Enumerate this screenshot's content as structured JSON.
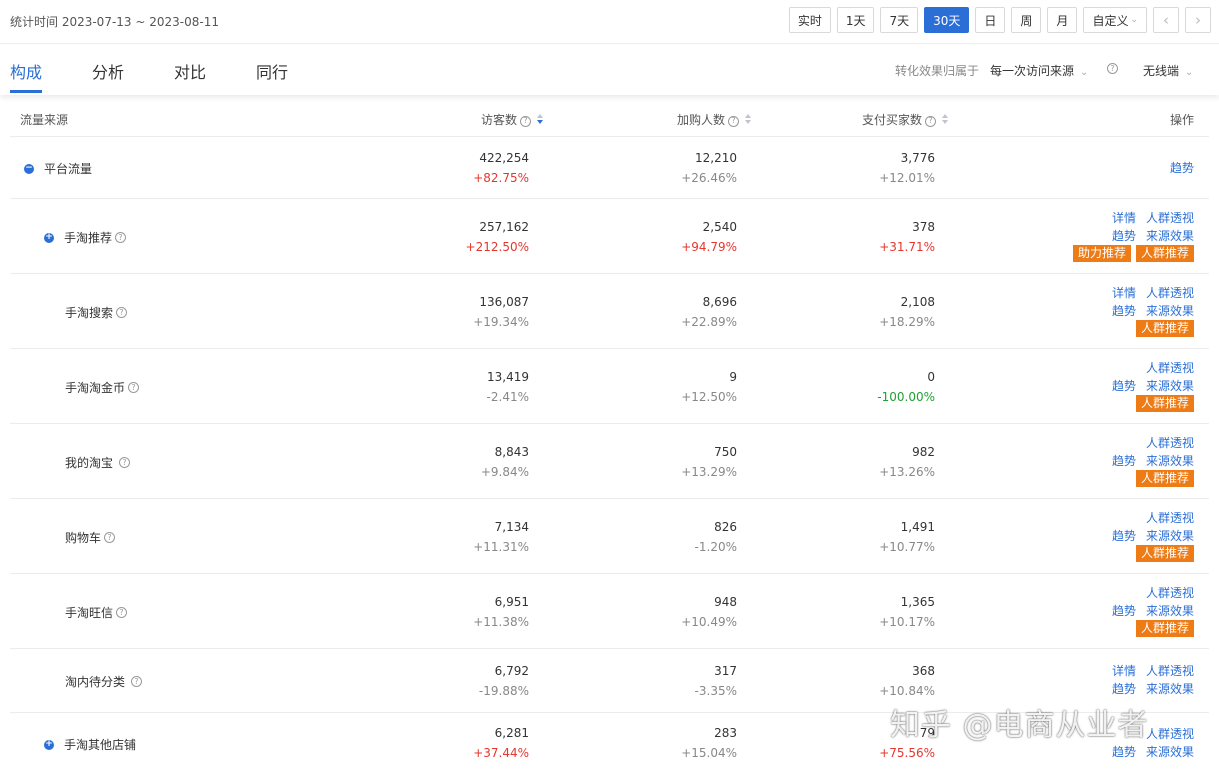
{
  "header": {
    "date_range": "统计时间 2023-07-13 ~ 2023-08-11",
    "periods": [
      {
        "label": "实时",
        "active": false
      },
      {
        "label": "1天",
        "active": false
      },
      {
        "label": "7天",
        "active": false
      },
      {
        "label": "30天",
        "active": true
      },
      {
        "label": "日",
        "active": false
      },
      {
        "label": "周",
        "active": false
      },
      {
        "label": "月",
        "active": false
      },
      {
        "label": "自定义",
        "active": false
      }
    ],
    "prev_icon": "chevron-left-icon",
    "next_icon": "chevron-right-icon"
  },
  "tabs": [
    "构成",
    "分析",
    "对比",
    "同行"
  ],
  "active_tab": "构成",
  "attribution": {
    "label": "转化效果归属于",
    "selected": "每一次访问来源",
    "device": "无线端"
  },
  "table": {
    "columns": [
      "流量来源",
      "访客数",
      "加购人数",
      "支付买家数",
      "操作"
    ],
    "rows": [
      {
        "source": "平台流量",
        "visitors": "422,254",
        "visitors_change": "+82.75%",
        "carts": "12,210",
        "carts_change": "+26.46%",
        "buyers": "3,776",
        "buyers_change": "+12.01%"
      },
      {
        "source": "手淘推荐",
        "visitors": "257,162",
        "visitors_change": "+212.50%",
        "carts": "2,540",
        "carts_change": "+94.79%",
        "buyers": "378",
        "buyers_change": "+31.71%"
      },
      {
        "source": "手淘搜索",
        "visitors": "136,087",
        "visitors_change": "+19.34%",
        "carts": "8,696",
        "carts_change": "+22.89%",
        "buyers": "2,108",
        "buyers_change": "+18.29%"
      },
      {
        "source": "手淘淘金币",
        "visitors": "13,419",
        "visitors_change": "-2.41%",
        "carts": "9",
        "carts_change": "+12.50%",
        "buyers": "0",
        "buyers_change": "-100.00%"
      },
      {
        "source": "我的淘宝",
        "visitors": "8,843",
        "visitors_change": "+9.84%",
        "carts": "750",
        "carts_change": "+13.29%",
        "buyers": "982",
        "buyers_change": "+13.26%"
      },
      {
        "source": "购物车",
        "visitors": "7,134",
        "visitors_change": "+11.31%",
        "carts": "826",
        "carts_change": "-1.20%",
        "buyers": "1,491",
        "buyers_change": "+10.77%"
      },
      {
        "source": "手淘旺信",
        "visitors": "6,951",
        "visitors_change": "+11.38%",
        "carts": "948",
        "carts_change": "+10.49%",
        "buyers": "1,365",
        "buyers_change": "+10.17%"
      },
      {
        "source": "淘内待分类",
        "visitors": "6,792",
        "visitors_change": "-19.88%",
        "carts": "317",
        "carts_change": "-3.35%",
        "buyers": "368",
        "buyers_change": "+10.84%"
      },
      {
        "source": "手淘其他店铺",
        "visitors": "6,281",
        "visitors_change": "+37.44%",
        "carts": "283",
        "carts_change": "+15.04%",
        "buyers": "79",
        "buyers_change": "+75.56%"
      }
    ],
    "ops": {
      "trend": "趋势",
      "detail": "详情",
      "crowd": "人群透视",
      "effect": "来源效果",
      "assist": "助力推荐",
      "crowd_rec": "人群推荐"
    }
  },
  "watermark": "知乎 @电商从业者",
  "colors": {
    "accent": "#2b6fd6",
    "up": "#e6362e",
    "down": "#22a035",
    "badge": "#ed7b16"
  }
}
